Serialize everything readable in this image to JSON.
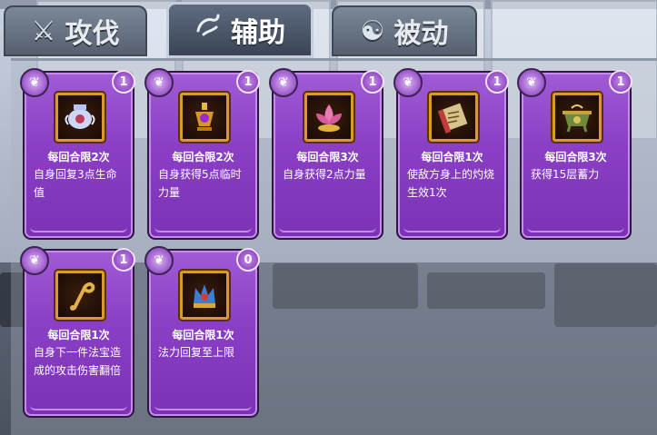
{
  "tabs": [
    {
      "label": "攻伐",
      "icon": "crossed-swords-icon"
    },
    {
      "label": "辅助",
      "icon": "dragon-icon"
    },
    {
      "label": "被动",
      "icon": "yin-yang-icon"
    }
  ],
  "active_tab": "辅助",
  "colors": {
    "card": "#8a3fc4",
    "frame": "#d99a2b",
    "text": "#ffffff"
  },
  "cards": [
    {
      "limit": "每回合限2次",
      "desc": "自身回复3点生命值",
      "count": "1",
      "icon": "vase-icon"
    },
    {
      "limit": "每回合限2次",
      "desc": "自身获得5点临时力量",
      "count": "1",
      "icon": "lamp-icon"
    },
    {
      "limit": "每回合限3次",
      "desc": "自身获得2点力量",
      "count": "1",
      "icon": "lotus-icon"
    },
    {
      "limit": "每回合限1次",
      "desc": "使敌方身上的灼烧生效1次",
      "count": "1",
      "icon": "scroll-icon"
    },
    {
      "limit": "每回合限3次",
      "desc": "获得15层蓄力",
      "count": "1",
      "icon": "cauldron-icon"
    },
    {
      "limit": "每回合限1次",
      "desc": "自身下一件法宝造成的攻击伤害翻倍",
      "count": "1",
      "icon": "hook-icon"
    },
    {
      "limit": "每回合限1次",
      "desc": "法力回复至上限",
      "count": "0",
      "icon": "crown-icon"
    }
  ]
}
